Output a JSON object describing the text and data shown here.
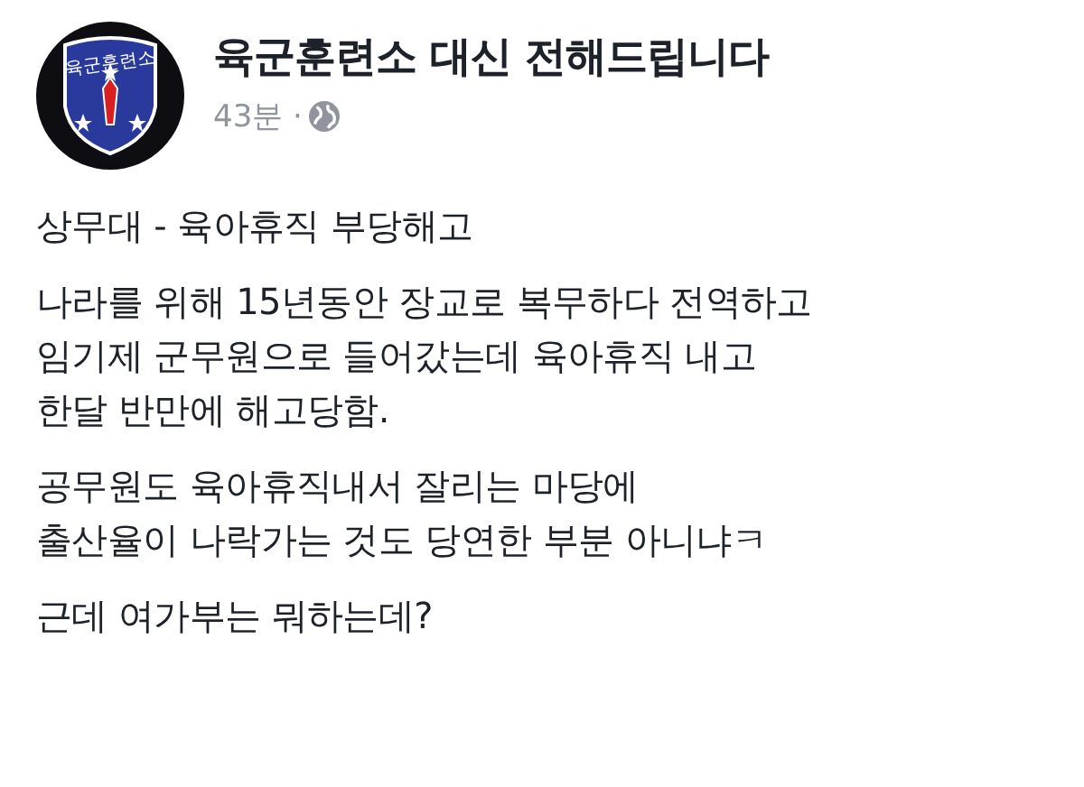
{
  "post": {
    "avatar_label": "육군훈련소",
    "author": "육군훈련소 대신 전해드립니다",
    "time": "43분 ·",
    "paragraphs": [
      [
        "상무대 - 육아휴직 부당해고"
      ],
      [
        "나라를 위해 15년동안 장교로 복무하다 전역하고",
        "임기제 군무원으로 들어갔는데 육아휴직 내고",
        "한달 반만에 해고당함."
      ],
      [
        "공무원도 육아휴직내서 잘리는 마당에",
        "출산율이 나락가는 것도 당연한 부분 아니냐ㅋ"
      ],
      [
        "근데 여가부는 뭐하는데?"
      ]
    ]
  }
}
